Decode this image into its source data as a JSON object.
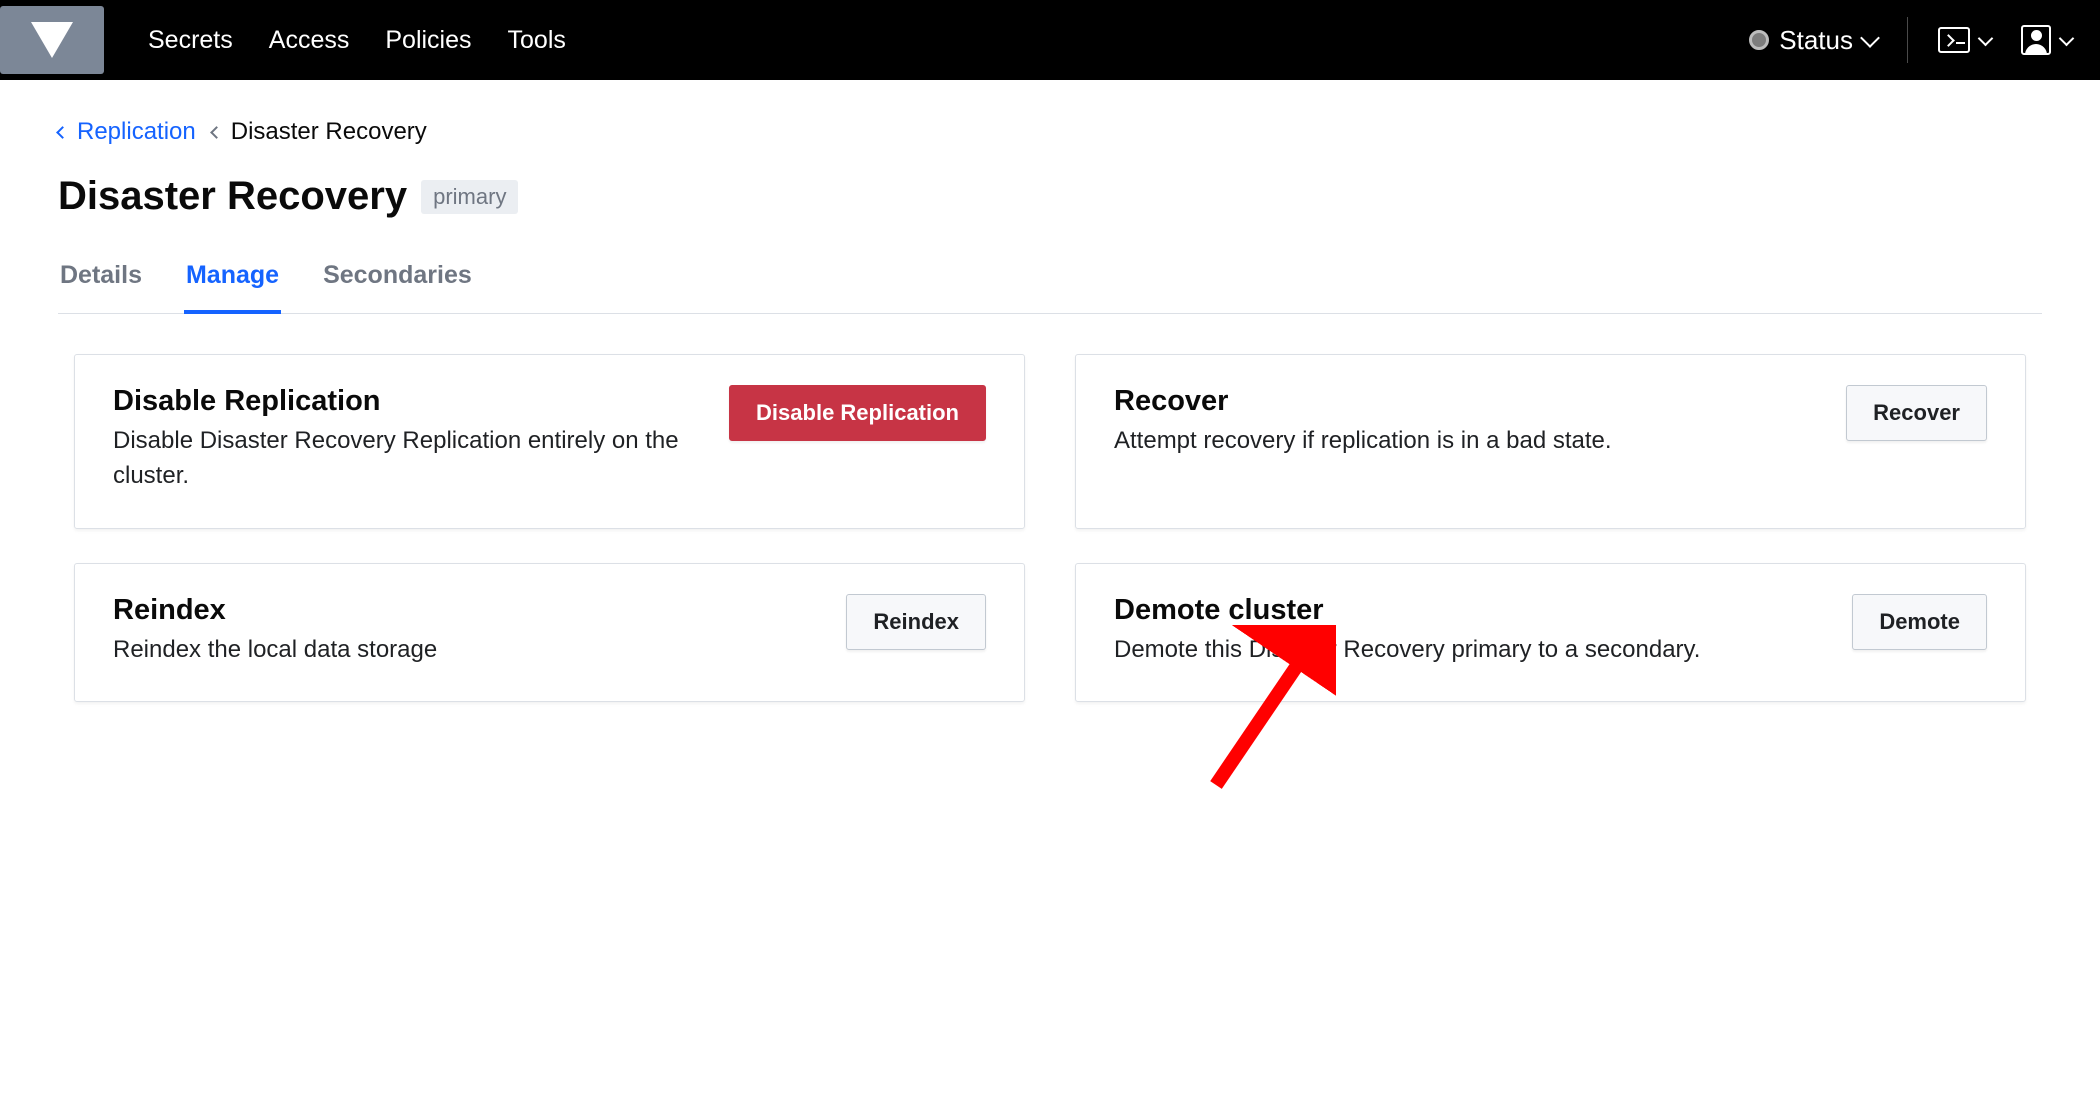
{
  "nav": {
    "links": [
      "Secrets",
      "Access",
      "Policies",
      "Tools"
    ],
    "status_label": "Status"
  },
  "breadcrumb": {
    "parent": "Replication",
    "current": "Disaster Recovery"
  },
  "page": {
    "title": "Disaster Recovery",
    "badge": "primary"
  },
  "tabs": [
    "Details",
    "Manage",
    "Secondaries"
  ],
  "activeTab": "Manage",
  "cards": [
    {
      "title": "Disable Replication",
      "desc": "Disable Disaster Recovery Replication entirely on the cluster.",
      "button": "Disable Replication",
      "variant": "danger"
    },
    {
      "title": "Recover",
      "desc": "Attempt recovery if replication is in a bad state.",
      "button": "Recover",
      "variant": "default"
    },
    {
      "title": "Reindex",
      "desc": "Reindex the local data storage",
      "button": "Reindex",
      "variant": "default"
    },
    {
      "title": "Demote cluster",
      "desc": "Demote this Disaster Recovery primary to a secondary.",
      "button": "Demote",
      "variant": "default"
    }
  ]
}
